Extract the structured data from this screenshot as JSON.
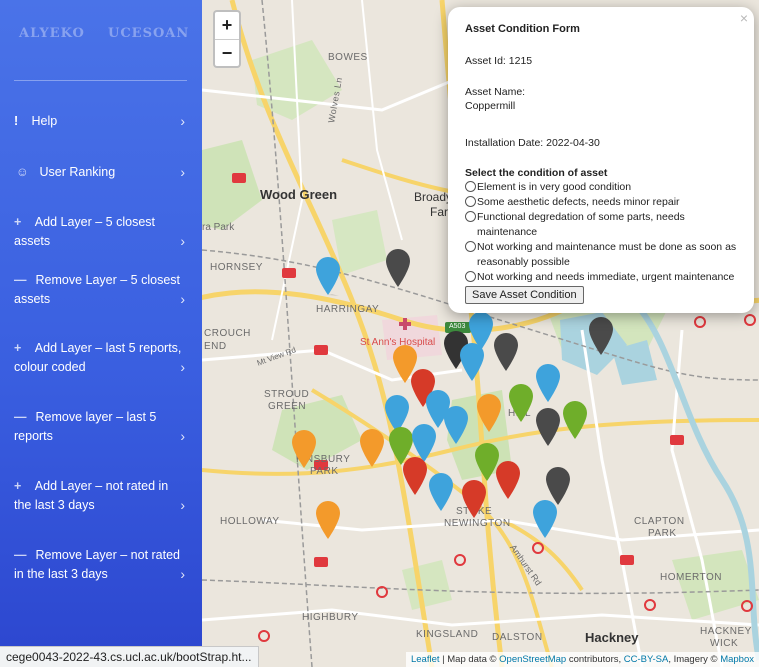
{
  "sidebar": {
    "brand_left": "ALYEKO",
    "brand_right": "UCESOAN",
    "items": [
      {
        "icon": "!",
        "icon_name": "exclamation-icon",
        "label": "Help"
      },
      {
        "icon": "☺",
        "icon_name": "user-icon",
        "label": "User Ranking"
      },
      {
        "icon": "+",
        "icon_name": "plus-icon",
        "label": "Add Layer – 5 closest assets"
      },
      {
        "icon": "—",
        "icon_name": "minus-icon",
        "label": "Remove Layer – 5 closest assets"
      },
      {
        "icon": "+",
        "icon_name": "plus-icon",
        "label": "Add Layer – last 5 reports, colour coded"
      },
      {
        "icon": "—",
        "icon_name": "minus-icon",
        "label": "Remove layer – last 5 reports"
      },
      {
        "icon": "+",
        "icon_name": "plus-icon",
        "label": "Add Layer – not rated in the last 3 days"
      },
      {
        "icon": "—",
        "icon_name": "minus-icon",
        "label": "Remove Layer – not rated in the last 3 days"
      }
    ]
  },
  "map": {
    "zoom_in": "+",
    "zoom_out": "−",
    "labels": {
      "bowes": "BOWES",
      "wolves_ln": "Wolves Ln",
      "wood_green": "Wood Green",
      "broadway": "Broady",
      "far": "Far",
      "ra_park": "ra Park",
      "hornsey": "HORNSEY",
      "harringay": "HARRINGAY",
      "st_anns": "St Ann's Hospital",
      "a503": "A503",
      "crouch": "CROUCH",
      "end": "END",
      "mt_view_rd": "Mt View Rd",
      "stroud": "STROUD",
      "green": "GREEN",
      "finsbury": "FINSBURY",
      "park": "PARK",
      "hill": "HILL",
      "holloway": "HOLLOWAY",
      "stoke": "STOKE",
      "newington": "NEWINGTON",
      "amhurst_rd": "Amhurst Rd",
      "clapton": "CLAPTON",
      "clapton_park": "PARK",
      "homerton": "HOMERTON",
      "highbury": "HIGHBURY",
      "kingsland": "KINGSLAND",
      "dalston": "DALSTON",
      "hackney": "Hackney",
      "hackney_wick1": "HACKNEY",
      "hackney_wick2": "WICK"
    },
    "attribution": {
      "leaflet": "Leaflet",
      "sep1": " | Map data © ",
      "osm": "OpenStreetMap",
      "sep2": " contributors, ",
      "ccbysa": "CC-BY-SA",
      "sep3": ", Imagery © ",
      "mapbox": "Mapbox"
    }
  },
  "popup": {
    "close": "×",
    "title": "Asset Condition Form",
    "asset_id": "Asset Id: 1215",
    "asset_name_label": "Asset Name:",
    "asset_name": "Coppermill",
    "install_date": "Installation Date: 2022-04-30",
    "question": "Select the condition of asset",
    "options": [
      "Element is in very good condition",
      "Some aesthetic defects, needs minor repair",
      "Functional degredation of some parts, needs maintenance",
      "Not working and maintenance must be done as soon as reasonably possible",
      "Not working and needs immediate, urgent maintenance"
    ],
    "submit": "Save Asset Condition"
  },
  "status_bar": {
    "url": "cege0043-2022-43.cs.ucl.ac.uk/bootStrap.ht..."
  },
  "colors": {
    "blue": "#3ea3dc",
    "grey": "#4a4a4a",
    "orange": "#f39a2b",
    "red": "#d63a28",
    "green": "#6fae2a"
  }
}
